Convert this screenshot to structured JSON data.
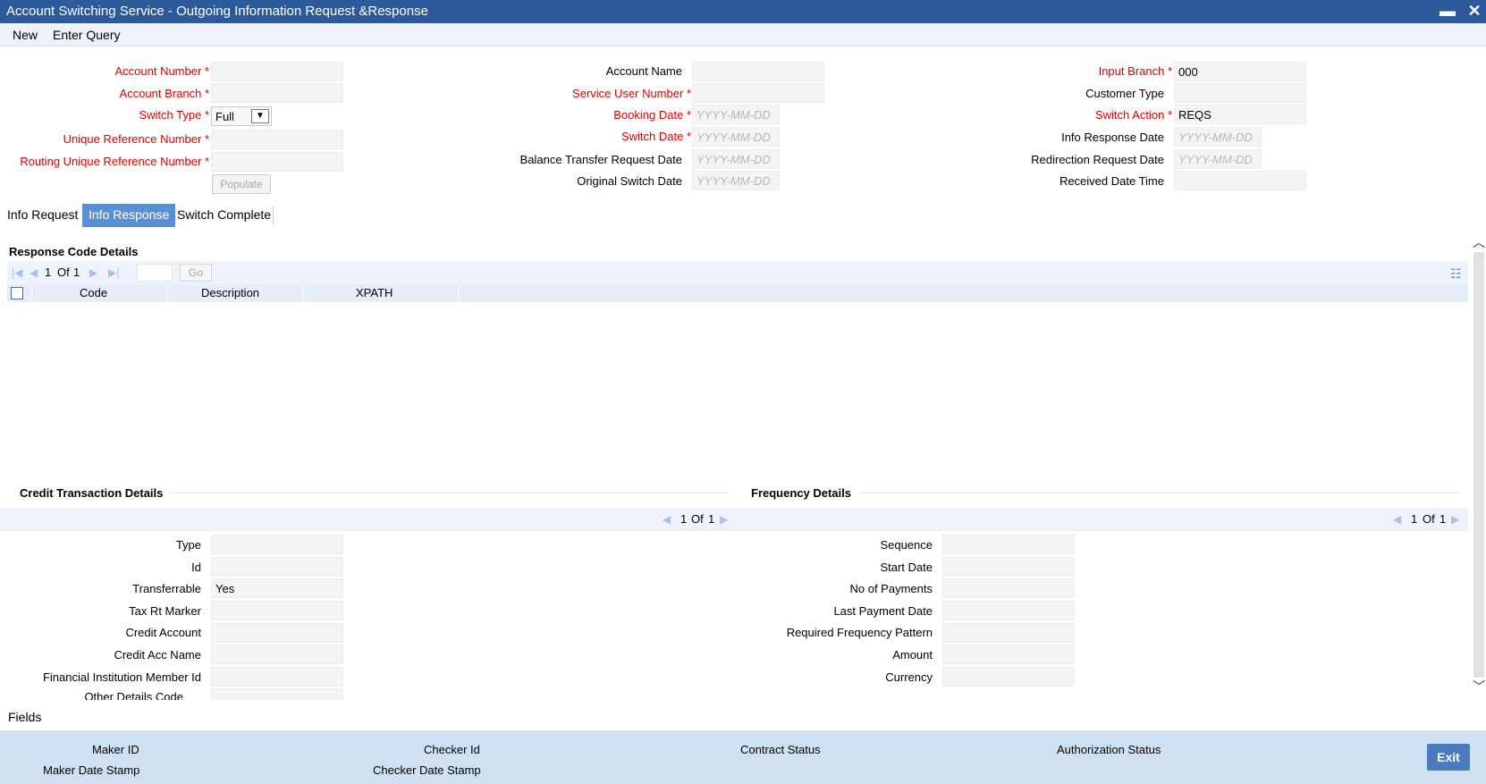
{
  "window": {
    "title": "Account Switching Service - Outgoing Information Request &Response",
    "minimize": "▬",
    "close": "✕"
  },
  "menu": {
    "new": "New",
    "enter_query": "Enter Query"
  },
  "header": {
    "col1": {
      "account_number": "Account Number",
      "account_branch": "Account Branch",
      "switch_type": "Switch Type",
      "switch_type_value": "Full",
      "unique_ref": "Unique Reference Number",
      "routing_ref": "Routing Unique Reference Number",
      "populate": "Populate"
    },
    "col2": {
      "account_name": "Account Name",
      "service_user_number": "Service User Number",
      "booking_date": "Booking Date",
      "switch_date": "Switch Date",
      "balance_transfer_date": "Balance Transfer Request Date",
      "original_switch_date": "Original Switch Date",
      "date_placeholder": "YYYY-MM-DD"
    },
    "col3": {
      "input_branch": "Input Branch",
      "input_branch_value": "000",
      "customer_type": "Customer Type",
      "switch_action": "Switch Action",
      "switch_action_value": "REQS",
      "info_response_date": "Info Response Date",
      "redirection_date": "Redirection Request Date",
      "received_date_time": "Received Date Time"
    },
    "required_mark": "*"
  },
  "tabs": [
    "Info Request",
    "Info Response",
    "Switch Complete"
  ],
  "response_code": {
    "title": "Response Code Details",
    "pager": {
      "page": "1",
      "of": "Of",
      "total": "1",
      "go": "Go"
    },
    "columns": [
      "Code",
      "Description",
      "XPATH"
    ]
  },
  "credit": {
    "title": "Credit Transaction Details",
    "pager": {
      "page": "1",
      "of": "Of",
      "total": "1"
    },
    "fields": {
      "type": "Type",
      "id": "Id",
      "transferrable": "Transferrable",
      "transferrable_value": "Yes",
      "tax_rt_marker": "Tax Rt Marker",
      "credit_account": "Credit Account",
      "credit_acc_name": "Credit Acc Name",
      "fi_member_id": "Financial Institution Member Id",
      "other_details_code": "Other Details Code"
    }
  },
  "frequency": {
    "title": "Frequency Details",
    "pager": {
      "page": "1",
      "of": "Of",
      "total": "1"
    },
    "fields": {
      "sequence": "Sequence",
      "start_date": "Start Date",
      "no_of_payments": "No of Payments",
      "last_payment_date": "Last Payment Date",
      "required_frequency_pattern": "Required Frequency Pattern",
      "amount": "Amount",
      "currency": "Currency"
    }
  },
  "fields_link": "Fields",
  "footer": {
    "maker_id": "Maker ID",
    "maker_date_stamp": "Maker Date Stamp",
    "checker_id": "Checker Id",
    "checker_date_stamp": "Checker Date Stamp",
    "contract_status": "Contract Status",
    "authorization_status": "Authorization Status",
    "exit": "Exit"
  },
  "colors": {
    "titlebar": "#2d5a9a",
    "tab_active": "#5b8fd3",
    "required": "#e00000",
    "footer": "#cfe0f2"
  }
}
